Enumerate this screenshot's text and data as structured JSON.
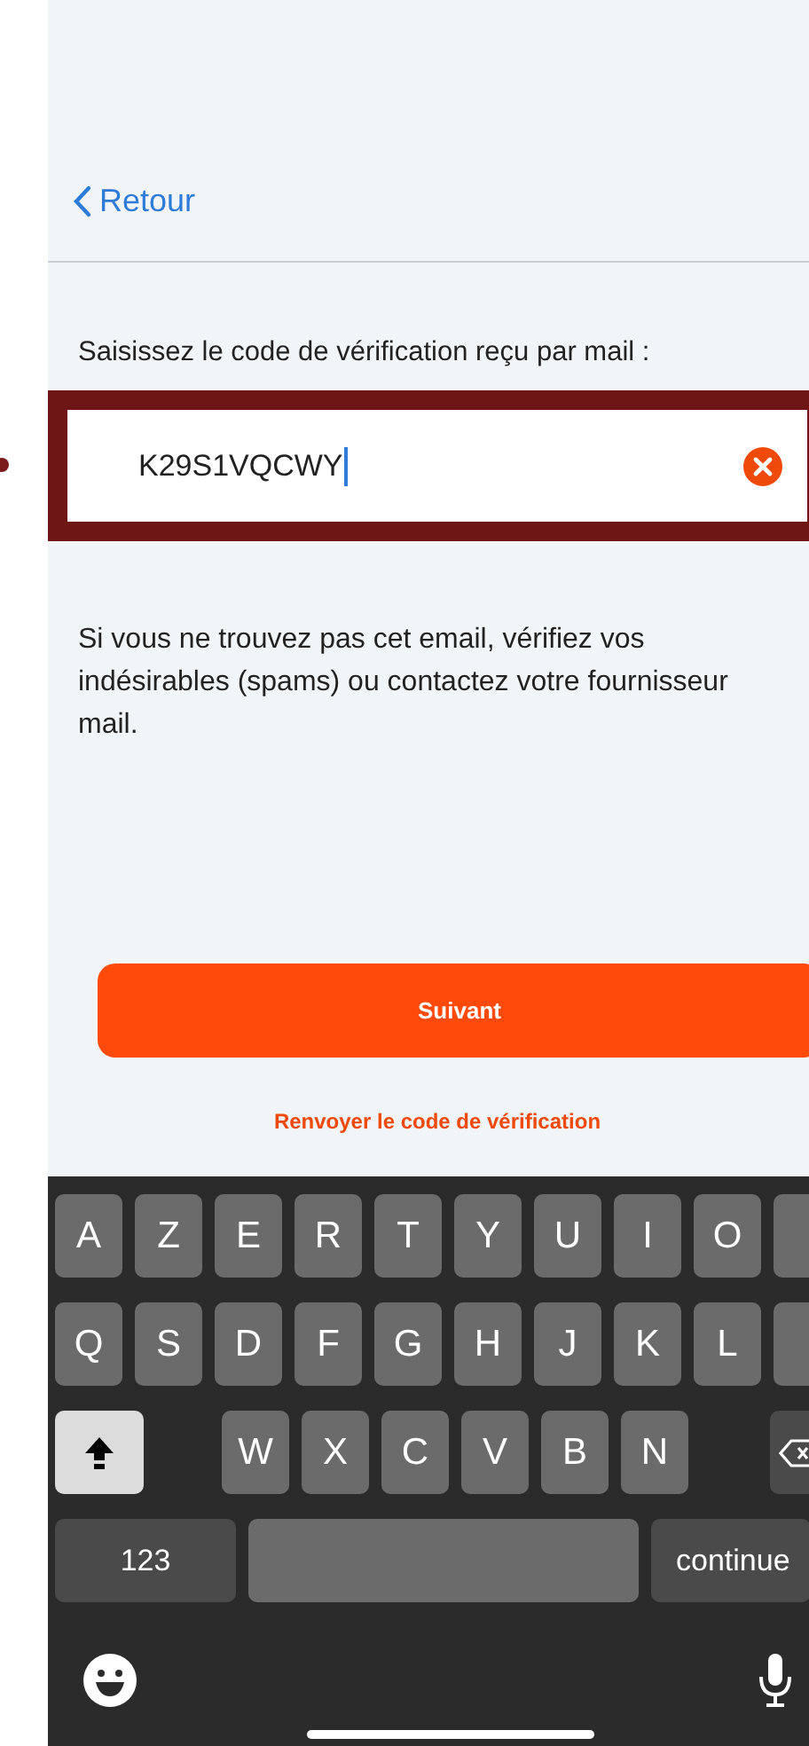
{
  "nav": {
    "back_label": "Retour"
  },
  "prompt": "Saisissez le code de vérification reçu par mail :",
  "code_field": {
    "value": "K29S1VQCWY",
    "highlighted": true
  },
  "help_text": "Si vous ne trouvez pas cet email, vérifiez vos indésirables (spams) ou contactez votre fournisseur mail.",
  "next_button": "Suivant",
  "resend_link": "Renvoyer le code de vérification",
  "keyboard": {
    "rows": [
      {
        "keys": [
          {
            "kind": "letter",
            "label": "A"
          },
          {
            "kind": "letter",
            "label": "Z"
          },
          {
            "kind": "letter",
            "label": "E"
          },
          {
            "kind": "letter",
            "label": "R"
          },
          {
            "kind": "letter",
            "label": "T"
          },
          {
            "kind": "letter",
            "label": "Y"
          },
          {
            "kind": "letter",
            "label": "U"
          },
          {
            "kind": "letter",
            "label": "I"
          },
          {
            "kind": "letter",
            "label": "O"
          },
          {
            "kind": "cut"
          }
        ]
      },
      {
        "keys": [
          {
            "kind": "letter",
            "label": "Q"
          },
          {
            "kind": "letter",
            "label": "S"
          },
          {
            "kind": "letter",
            "label": "D"
          },
          {
            "kind": "letter",
            "label": "F"
          },
          {
            "kind": "letter",
            "label": "G"
          },
          {
            "kind": "letter",
            "label": "H"
          },
          {
            "kind": "letter",
            "label": "J"
          },
          {
            "kind": "letter",
            "label": "K"
          },
          {
            "kind": "letter",
            "label": "L"
          },
          {
            "kind": "cut"
          }
        ]
      },
      {
        "keys": [
          {
            "kind": "shift",
            "on": true
          },
          {
            "kind": "letter",
            "label": "W"
          },
          {
            "kind": "letter",
            "label": "X"
          },
          {
            "kind": "letter",
            "label": "C"
          },
          {
            "kind": "letter",
            "label": "V"
          },
          {
            "kind": "letter",
            "label": "B"
          },
          {
            "kind": "letter",
            "label": "N"
          },
          {
            "kind": "delete"
          }
        ]
      },
      {
        "keys": [
          {
            "kind": "numbers",
            "label": "123"
          },
          {
            "kind": "space"
          },
          {
            "kind": "return",
            "label": "continue"
          }
        ]
      }
    ]
  }
}
